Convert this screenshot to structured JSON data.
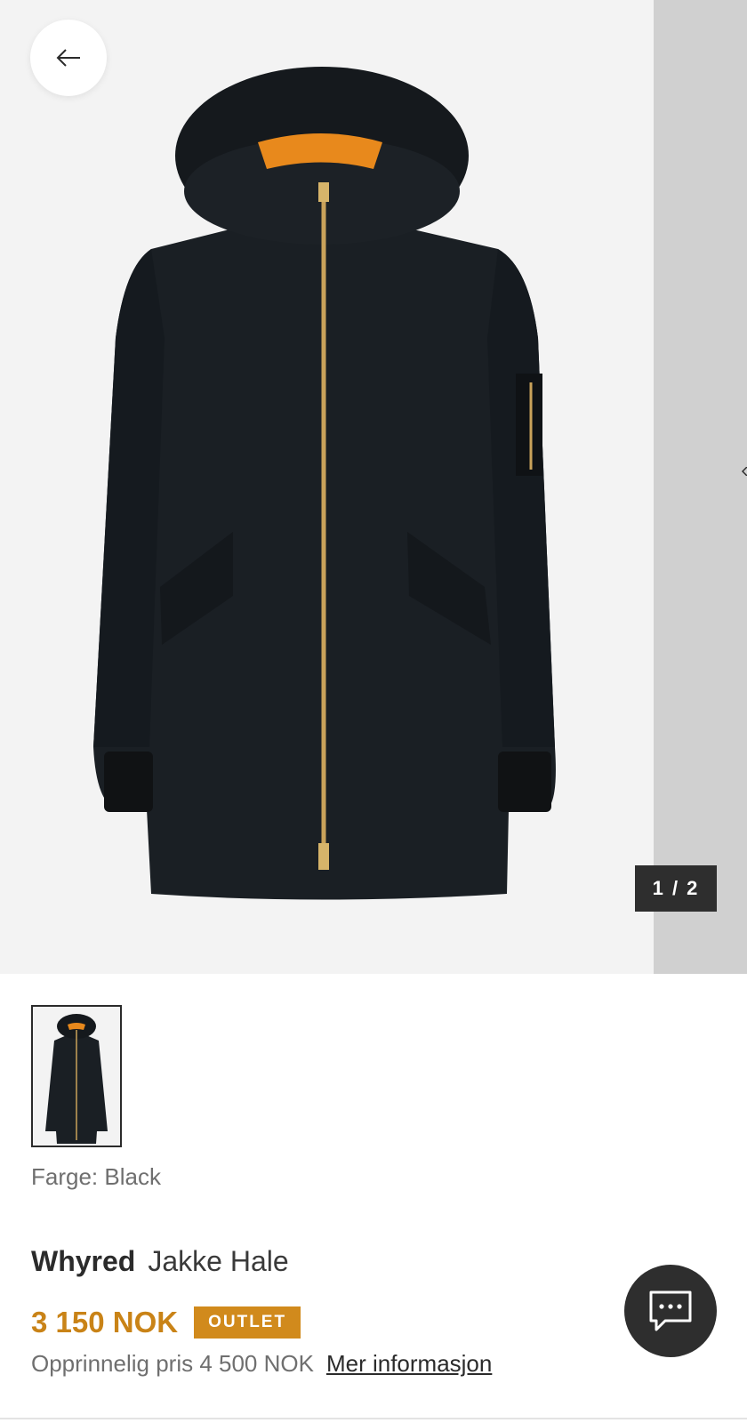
{
  "gallery": {
    "counter": "1 / 2",
    "icons": {
      "back": "arrow-left-icon"
    }
  },
  "product": {
    "color_line": "Farge: Black",
    "brand": "Whyred",
    "name": "Jakke Hale",
    "price": "3 150 NOK",
    "badge": "OUTLET",
    "original_price": "Opprinnelig pris 4 500 NOK",
    "more_info": "Mer informasjon"
  },
  "colors": {
    "accent_price": "#c98317",
    "badge_bg": "#d18a1c",
    "dark": "#2e2e2e",
    "jacket": "#1a1f24",
    "lining": "#e8891c",
    "zipper": "#c9a25a"
  },
  "icons": {
    "chat": "chat-bubble-icon"
  }
}
